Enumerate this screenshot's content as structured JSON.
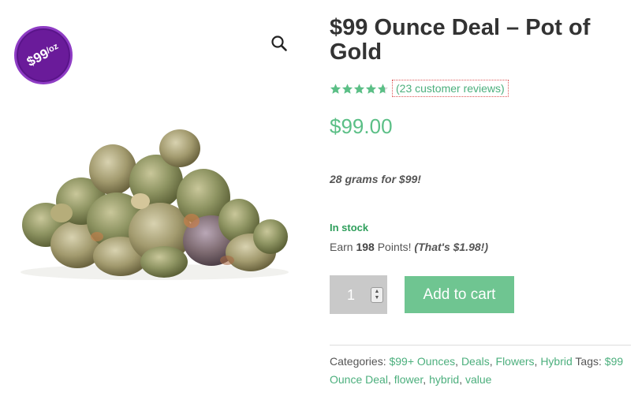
{
  "badge": {
    "price": "$99",
    "unit": "/oz",
    "color": "#6a1b9a"
  },
  "gallery": {
    "zoom_icon": "magnifier-icon",
    "image_alt": "product-image"
  },
  "product": {
    "title": "$99 Ounce Deal – Pot of Gold",
    "rating": {
      "stars": 4.7,
      "max": 5,
      "review_text": "(23 customer reviews)"
    },
    "price": "$99.00",
    "short_description": "28 grams for $99!",
    "stock": "In stock",
    "points": {
      "prefix": "Earn",
      "amount": "198",
      "label": "Points!",
      "value_note": "(That's $1.98!)"
    },
    "quantity": "1",
    "add_to_cart": "Add to cart"
  },
  "meta": {
    "categories_label": "Categories:",
    "categories": [
      "$99+ Ounces",
      "Deals",
      "Flowers",
      "Hybrid"
    ],
    "tags_label": "Tags:",
    "tags": [
      "$99 Ounce Deal",
      "flower",
      "hybrid",
      "value"
    ]
  },
  "colors": {
    "accent": "#5bbf86",
    "button": "#6fc591",
    "stock": "#2e9e5b",
    "star": "#5bbf86"
  }
}
